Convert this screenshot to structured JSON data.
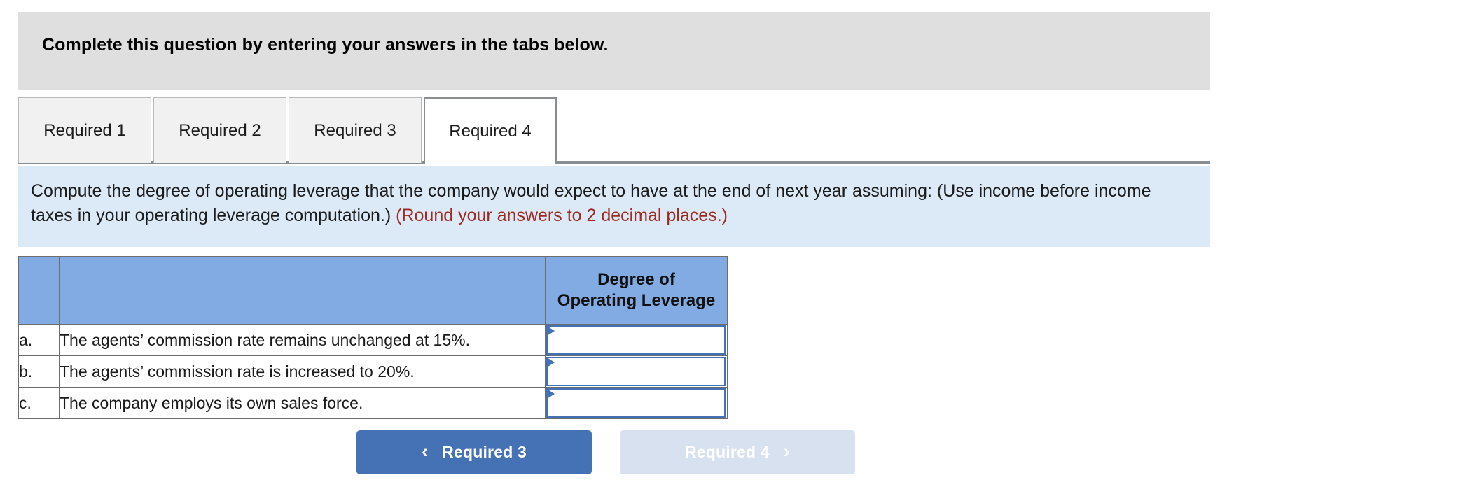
{
  "header": {
    "instruction": "Complete this question by entering your answers in the tabs below."
  },
  "tabs": {
    "items": [
      {
        "label": "Required 1",
        "active": false
      },
      {
        "label": "Required 2",
        "active": false
      },
      {
        "label": "Required 3",
        "active": false
      },
      {
        "label": "Required 4",
        "active": true
      }
    ]
  },
  "prompt": {
    "main": "Compute the degree of operating leverage that the company would expect to have at the end of next year assuming: (Use income before income taxes in your operating leverage computation.)",
    "round_note": "(Round your answers to 2 decimal places.)"
  },
  "table": {
    "headers": {
      "label": "",
      "description": "",
      "answer_line1": "Degree of",
      "answer_line2": "Operating Leverage"
    },
    "rows": [
      {
        "label": "a.",
        "description": "The agents’ commission rate remains unchanged at 15%.",
        "answer": "",
        "placeholder": ""
      },
      {
        "label": "b.",
        "description": "The agents’ commission rate is increased to 20%.",
        "answer": "",
        "placeholder": ""
      },
      {
        "label": "c.",
        "description": "The company employs its own sales force.",
        "answer": "",
        "placeholder": ""
      }
    ]
  },
  "navigation": {
    "prev_label": "Required 3",
    "prev_icon": "chevron-left-icon",
    "prev_glyph": "‹",
    "next_label": "Required 4",
    "next_icon": "chevron-right-icon",
    "next_glyph": "›",
    "next_disabled": true
  },
  "colors": {
    "header_banner_bg": "#dfdfdf",
    "prompt_bg": "#dce9f7",
    "round_note_text": "#9c2b20",
    "table_header_bg": "#82aae3",
    "input_border": "#4472b4",
    "nav_active_bg": "#4472b4",
    "nav_disabled_bg": "#d8e1ef",
    "tab_inactive_bg": "#f1f1f1",
    "tab_active_bg": "#ffffff"
  }
}
